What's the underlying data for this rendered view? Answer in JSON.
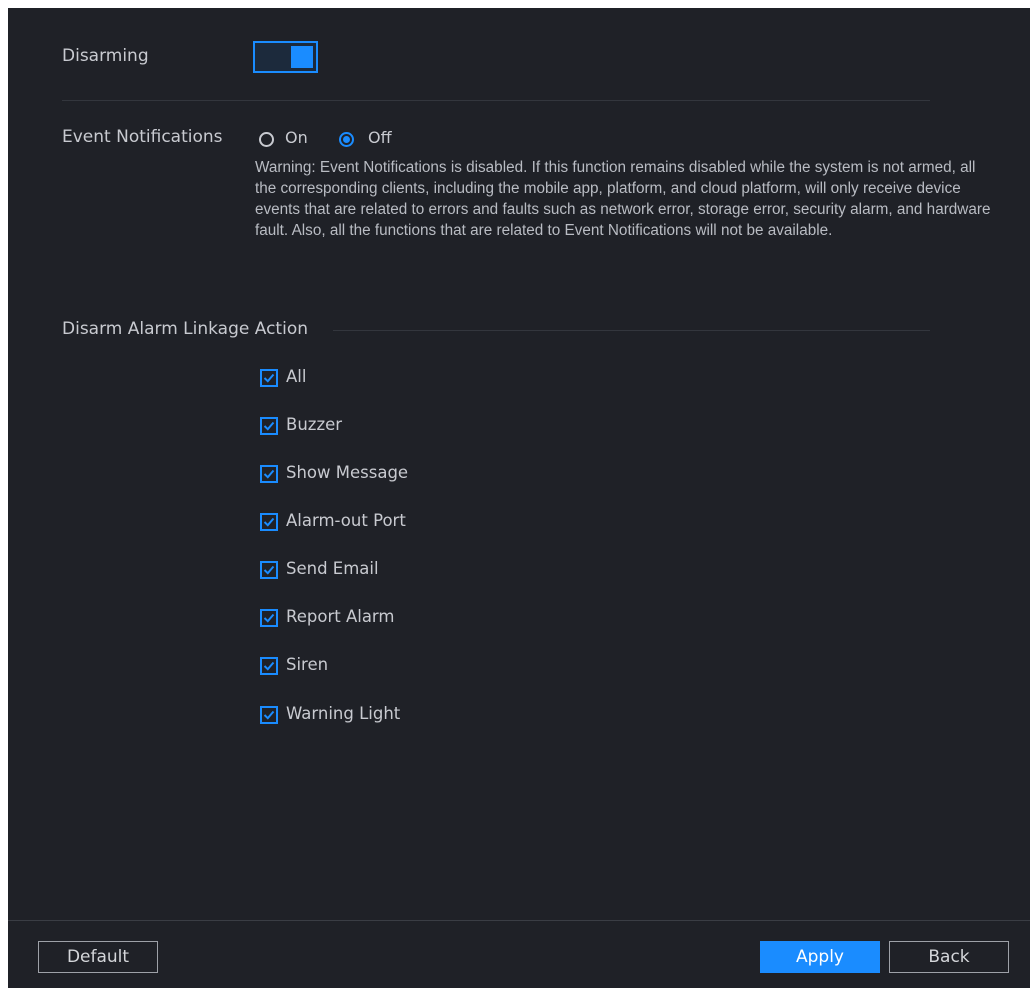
{
  "disarming": {
    "label": "Disarming",
    "enabled": true
  },
  "event_notifications": {
    "label": "Event Notifications",
    "on_label": "On",
    "off_label": "Off",
    "selected": "Off",
    "warning": "Warning: Event Notifications is disabled. If this function remains disabled while the system is not armed, all the corresponding clients, including the mobile app, platform, and cloud platform, will only receive device events that are related to errors and faults such as network error, storage error, security alarm, and hardware fault. Also, all the functions that are related to Event Notifications will not be available."
  },
  "linkage": {
    "title": "Disarm Alarm Linkage Action",
    "items": [
      {
        "label": "All",
        "checked": true
      },
      {
        "label": "Buzzer",
        "checked": true
      },
      {
        "label": "Show Message",
        "checked": true
      },
      {
        "label": "Alarm-out Port",
        "checked": true
      },
      {
        "label": "Send Email",
        "checked": true
      },
      {
        "label": "Report Alarm",
        "checked": true
      },
      {
        "label": "Siren",
        "checked": true
      },
      {
        "label": "Warning Light",
        "checked": true
      }
    ]
  },
  "footer": {
    "default_label": "Default",
    "apply_label": "Apply",
    "back_label": "Back"
  },
  "colors": {
    "accent": "#1a8cff",
    "background": "#1f2127"
  }
}
